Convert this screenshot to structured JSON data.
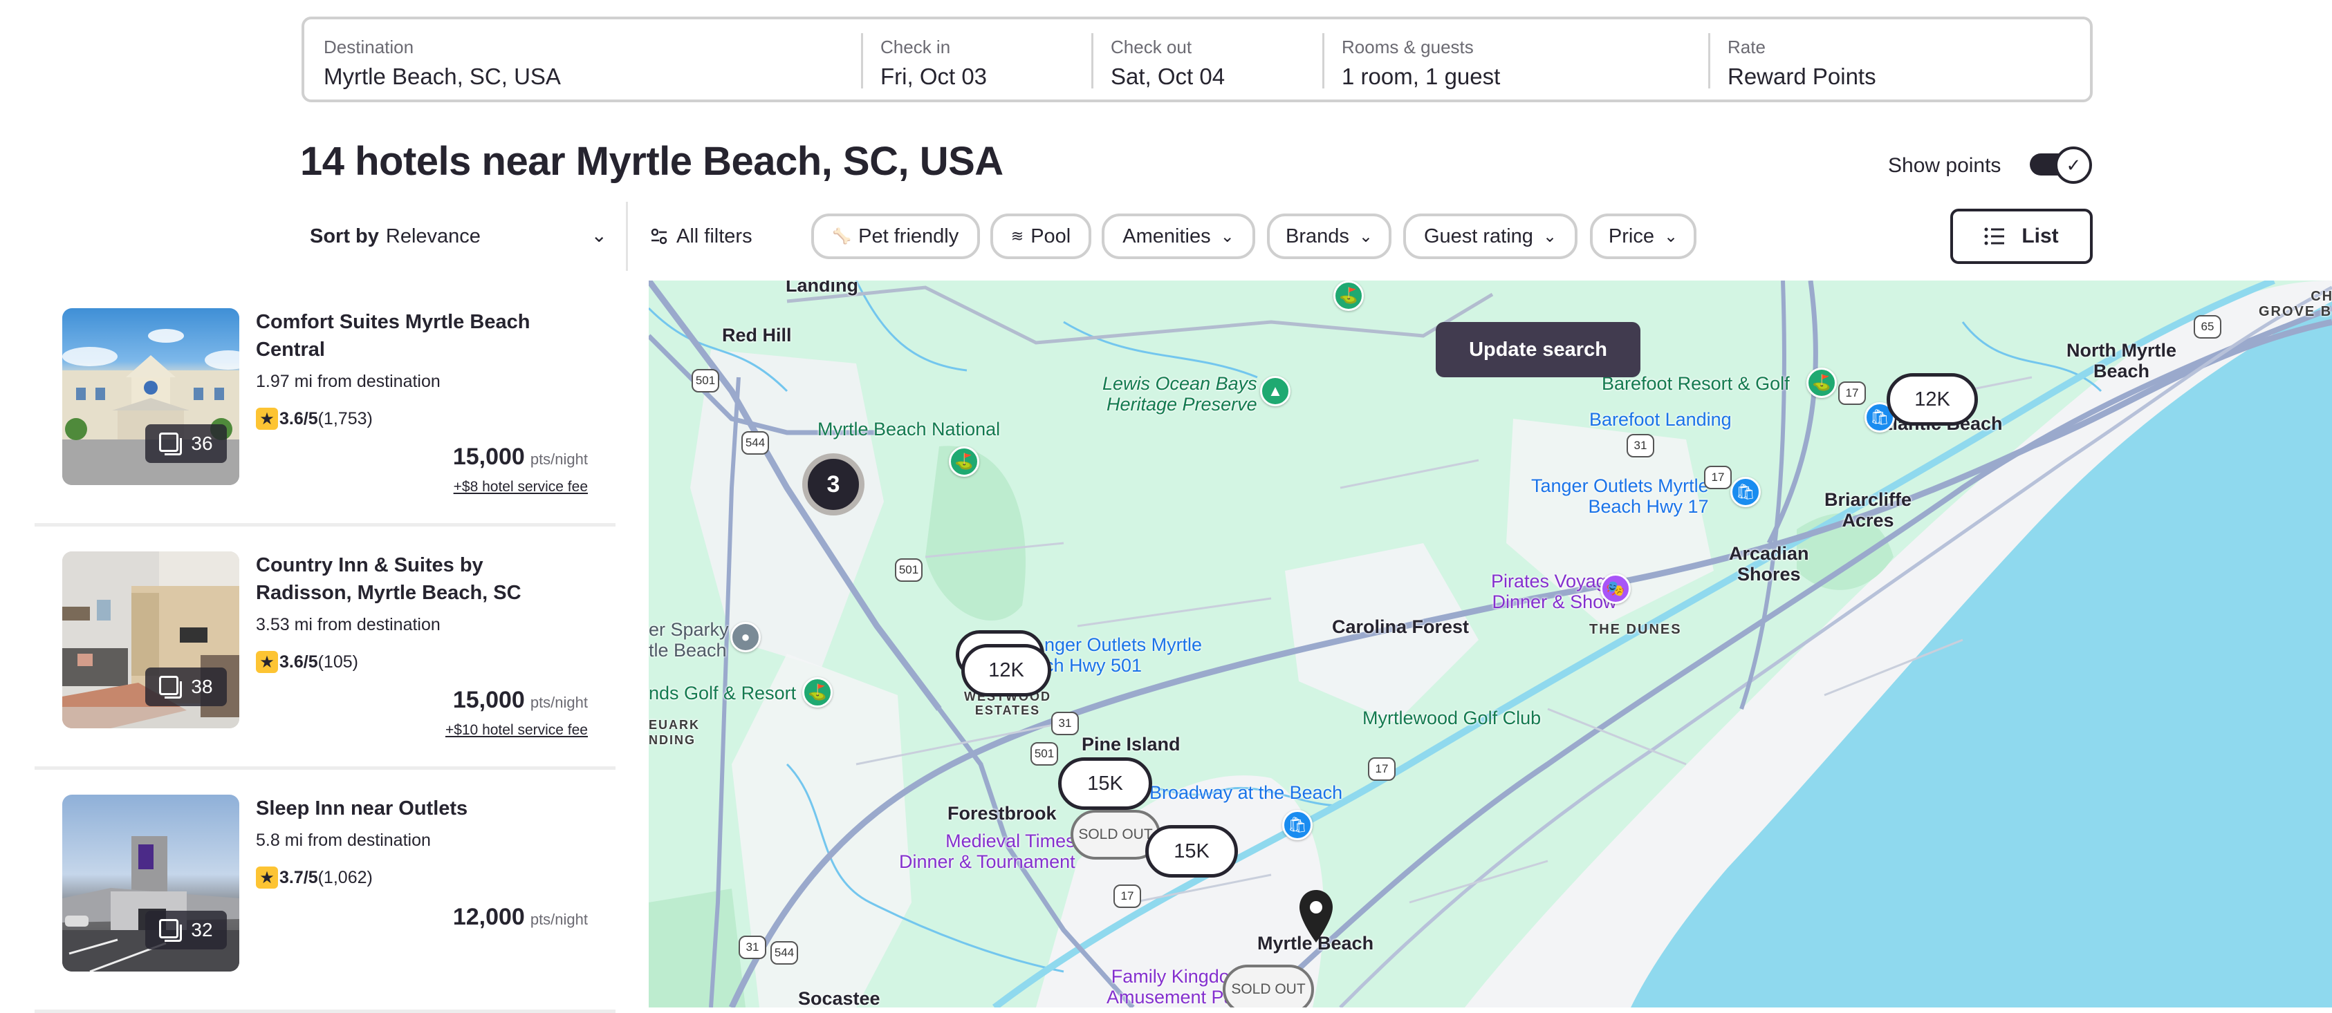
{
  "search": {
    "fields": [
      {
        "label": "Destination",
        "value": "Myrtle Beach, SC, USA"
      },
      {
        "label": "Check in",
        "value": "Fri, Oct 03"
      },
      {
        "label": "Check out",
        "value": "Sat, Oct 04"
      },
      {
        "label": "Rooms & guests",
        "value": "1 room, 1 guest"
      },
      {
        "label": "Rate",
        "value": "Reward Points"
      }
    ]
  },
  "results": {
    "title": "14 hotels near Myrtle Beach, SC, USA",
    "show_points_label": "Show points",
    "show_points_on": true
  },
  "filters": {
    "sort_prefix": "Sort by",
    "sort_value": "Relevance",
    "all_filters": "All filters",
    "chips": [
      {
        "label": "Pet friendly",
        "icon": "paw-icon"
      },
      {
        "label": "Pool",
        "icon": "pool-icon"
      },
      {
        "label": "Amenities",
        "icon": "chevron-down-icon"
      },
      {
        "label": "Brands",
        "icon": "chevron-down-icon"
      },
      {
        "label": "Guest rating",
        "icon": "chevron-down-icon"
      },
      {
        "label": "Price",
        "icon": "chevron-down-icon"
      }
    ],
    "list_button": "List"
  },
  "hotels": [
    {
      "name": "Comfort Suites Myrtle Beach Central",
      "distance": "1.97 mi from destination",
      "rating": "3.6/5",
      "reviews": "(1,753)",
      "photos": "36",
      "price": "15,000",
      "unit": "pts/night",
      "fee": "+$8 hotel service fee"
    },
    {
      "name": "Country Inn & Suites by Radisson, Myrtle Beach, SC",
      "distance": "3.53 mi from destination",
      "rating": "3.6/5",
      "reviews": "(105)",
      "photos": "38",
      "price": "15,000",
      "unit": "pts/night",
      "fee": "+$10 hotel service fee"
    },
    {
      "name": "Sleep Inn near Outlets",
      "distance": "5.8 mi from destination",
      "rating": "3.7/5",
      "reviews": "(1,062)",
      "photos": "32",
      "price": "12,000",
      "unit": "pts/night",
      "fee": ""
    }
  ],
  "map": {
    "update_search": "Update search",
    "cluster_count": "3",
    "price_pins": [
      "12K",
      "12K",
      "15K",
      "15K",
      "12K"
    ],
    "sold_out_label": "SOLD OUT",
    "labels": {
      "landing": "Landing",
      "red_hill": "Red Hill",
      "mb_national": "Myrtle Beach National",
      "lewis": "Lewis Ocean Bays\nHeritage Preserve",
      "barefoot_resort": "Barefoot Resort & Golf",
      "barefoot_landing": "Barefoot Landing",
      "north_myrtle": "North Myrtle\nBeach",
      "cherry_grove": "CHERRY\nGROVE BEACH",
      "atlantic_beach": "Atlantic Beach",
      "tanger17": "Tanger Outlets Myrtle\nBeach Hwy 17",
      "briarcliffe": "Briarcliffe\nAcres",
      "arcadian": "Arcadian\nShores",
      "pirates": "Pirates Voyage\nDinner & Show",
      "the_dunes": "THE DUNES",
      "carolina_forest": "Carolina Forest",
      "sparky": "er Sparky\ntle Beach",
      "sands_golf": "nds Golf & Resort",
      "tanger501": "nger Outlets Myrtle\nch Hwy 501",
      "westwood": "WESTWOOD\nESTATES",
      "myrtlewood": "Myrtlewood Golf Club",
      "pine_island": "Pine Island",
      "broadway": "Broadway at the Beach",
      "forestbrook": "Forestbrook",
      "medieval": "Medieval Times\nDinner & Tournament",
      "neuark": "EUARK\nNDING",
      "myrtle_beach": "Myrtle Beach",
      "family_kingdom": "Family Kingdom\nAmusement Park",
      "socastee": "Socastee"
    },
    "shields": [
      "501",
      "544",
      "501",
      "31",
      "17",
      "17",
      "65",
      "31",
      "501",
      "17",
      "17",
      "31",
      "544"
    ]
  }
}
